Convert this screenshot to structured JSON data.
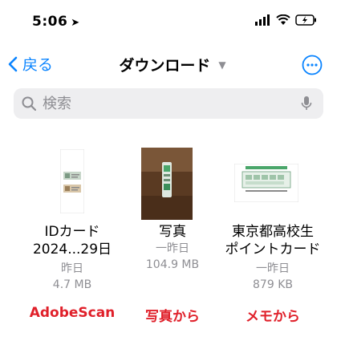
{
  "status_bar": {
    "time": "5:06",
    "location_icon": "location-arrow-icon"
  },
  "nav": {
    "back_label": "戻る",
    "title": "ダウンロード"
  },
  "search": {
    "placeholder": "検索"
  },
  "files": [
    {
      "name_line1": "IDカード",
      "name_line2": "2024...29日",
      "date": "昨日",
      "size": "4.7 MB",
      "tag": "AdobeScan"
    },
    {
      "name_line1": "写真",
      "name_line2": "",
      "date": "一昨日",
      "size": "104.9 MB",
      "tag": "写真から"
    },
    {
      "name_line1": "東京都高校生",
      "name_line2": "ポイントカード",
      "date": "一昨日",
      "size": "879 KB",
      "tag": "メモから"
    }
  ],
  "colors": {
    "accent": "#0a84ff",
    "tag": "#e0202a",
    "secondary_text": "#8e8e93"
  }
}
